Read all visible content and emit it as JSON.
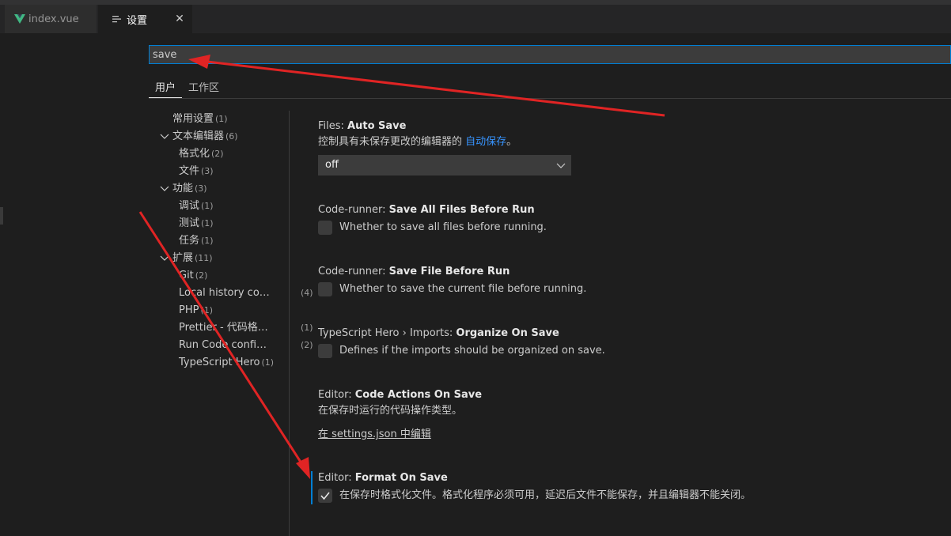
{
  "tabs": {
    "file_tab": {
      "label": "index.vue",
      "icon": "vue-icon"
    },
    "settings_tab": {
      "label": "设置",
      "icon": "settings-icon",
      "close_icon": "close-icon"
    }
  },
  "search": {
    "value": "save"
  },
  "scope_tabs": {
    "user": "用户",
    "workspace": "工作区"
  },
  "toc": [
    {
      "label": "常用设置",
      "count": "(1)"
    },
    {
      "label": "文本编辑器",
      "count": "(6)"
    },
    {
      "label": "格式化",
      "count": "(2)"
    },
    {
      "label": "文件",
      "count": "(3)"
    },
    {
      "label": "功能",
      "count": "(3)"
    },
    {
      "label": "调试",
      "count": "(1)"
    },
    {
      "label": "测试",
      "count": "(1)"
    },
    {
      "label": "任务",
      "count": "(1)"
    },
    {
      "label": "扩展",
      "count": "(11)"
    },
    {
      "label": "Git",
      "count": "(2)"
    },
    {
      "label": "Local history confi...",
      "count": "(4)"
    },
    {
      "label": "PHP",
      "count": "(1)"
    },
    {
      "label": "Prettier - 代码格式...",
      "count": "(1)"
    },
    {
      "label": "Run Code configur...",
      "count": "(2)"
    },
    {
      "label": "TypeScript Hero",
      "count": "(1)"
    }
  ],
  "settings": {
    "auto_save": {
      "category": "Files: ",
      "name": "Auto Save",
      "desc": "控制具有未保存更改的编辑器的 ",
      "link": "自动保存",
      "desc_end": "。",
      "value": "off"
    },
    "save_all": {
      "category": "Code-runner: ",
      "name": "Save All Files Before Run",
      "desc": "Whether to save all files before running.",
      "checked": false
    },
    "save_file": {
      "category": "Code-runner: ",
      "name": "Save File Before Run",
      "desc": "Whether to save the current file before running.",
      "checked": false
    },
    "organize": {
      "category": "TypeScript Hero › Imports: ",
      "name": "Organize On Save",
      "desc": "Defines if the imports should be organized on save.",
      "checked": false
    },
    "code_actions": {
      "category": "Editor: ",
      "name": "Code Actions On Save",
      "desc": "在保存时运行的代码操作类型。",
      "link": "在 settings.json 中编辑"
    },
    "format_on_save": {
      "category": "Editor: ",
      "name": "Format On Save",
      "desc": "在保存时格式化文件。格式化程序必须可用，延迟后文件不能保存，并且编辑器不能关闭。",
      "checked": true
    }
  },
  "colors": {
    "accent": "#007fd4",
    "link": "#3794ff",
    "arrow": "#e02424"
  }
}
